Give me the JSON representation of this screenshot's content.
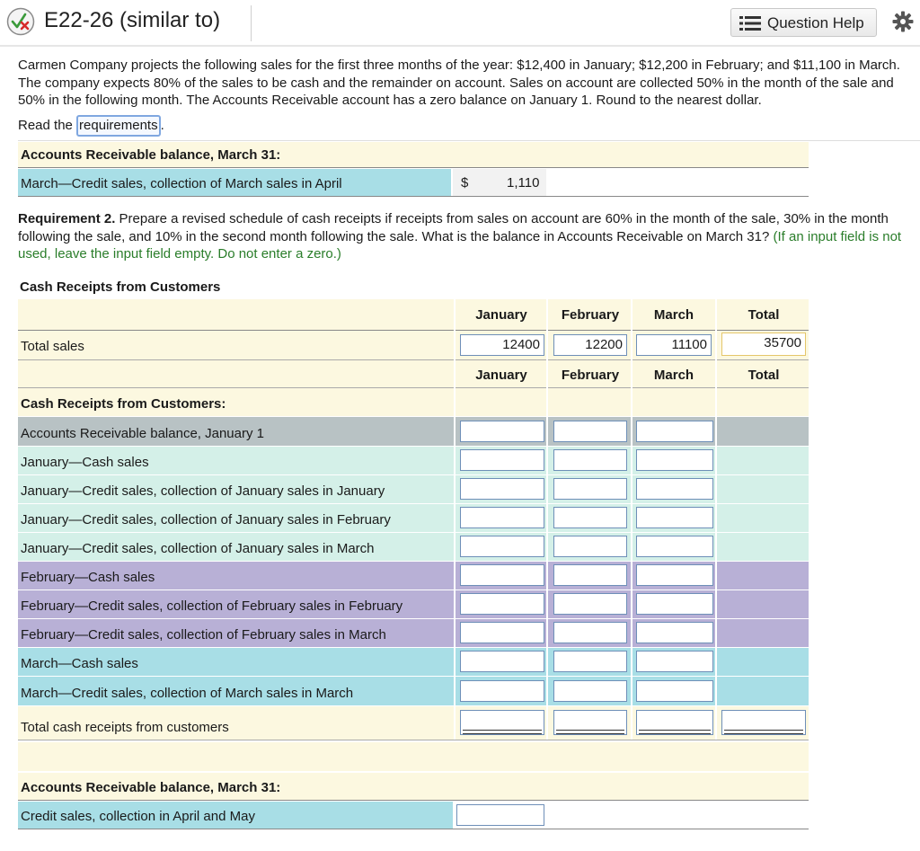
{
  "header": {
    "title": "E22-26 (similar to)",
    "question_help": "Question Help"
  },
  "intro": {
    "text": "Carmen Company projects the following sales for the first three months of the year: $12,400 in January; $12,200 in February; and $11,100 in March. The company expects 80% of the sales to be cash and the remainder on account. Sales on account are collected 50% in the month of the sale and 50% in the following month. The Accounts Receivable account has a zero balance on January 1. Round to the nearest dollar.",
    "read_prefix": "Read the ",
    "requirements_link": "requirements",
    "read_suffix": "."
  },
  "req1": {
    "ar_heading": "Accounts Receivable balance, March 31:",
    "row_label": "March—Credit sales, collection of March sales in April",
    "currency": "$",
    "value": "1,110"
  },
  "req2": {
    "label": "Requirement 2.",
    "text": " Prepare a revised schedule of cash receipts if receipts from sales on account are 60% in the month of the sale, 30% in the month following the sale, and 10% in the second month following the sale. What is the balance in Accounts Receivable on March 31?",
    "hint": " (If an input field is not used, leave the input field empty. Do not enter a zero.)"
  },
  "schedule": {
    "title": "Cash Receipts from Customers",
    "columns": [
      "January",
      "February",
      "March",
      "Total"
    ],
    "total_sales_label": "Total sales",
    "total_sales": [
      "12400",
      "12200",
      "11100",
      "35700"
    ],
    "section_heading": "Cash Receipts from Customers:",
    "rows": [
      "Accounts Receivable balance, January 1",
      "January—Cash sales",
      "January—Credit sales, collection of January sales in January",
      "January—Credit sales, collection of January sales in February",
      "January—Credit sales, collection of January sales in March",
      "February—Cash sales",
      "February—Credit sales, collection of February sales in February",
      "February—Credit sales, collection of February sales in March",
      "March—Cash sales",
      "March—Credit sales, collection of March sales in March"
    ],
    "total_row_label": "Total cash receipts from customers",
    "ar_heading": "Accounts Receivable balance, March 31:",
    "ar_row_label": "Credit sales, collection in April and May"
  },
  "colors": {
    "cream": "#fcf8e0",
    "teal": "#a8dee6",
    "mint": "#d4f0e8",
    "gray": "#b8c2c4",
    "lavender": "#b8b0d6",
    "hint_green": "#2a7d2a"
  }
}
